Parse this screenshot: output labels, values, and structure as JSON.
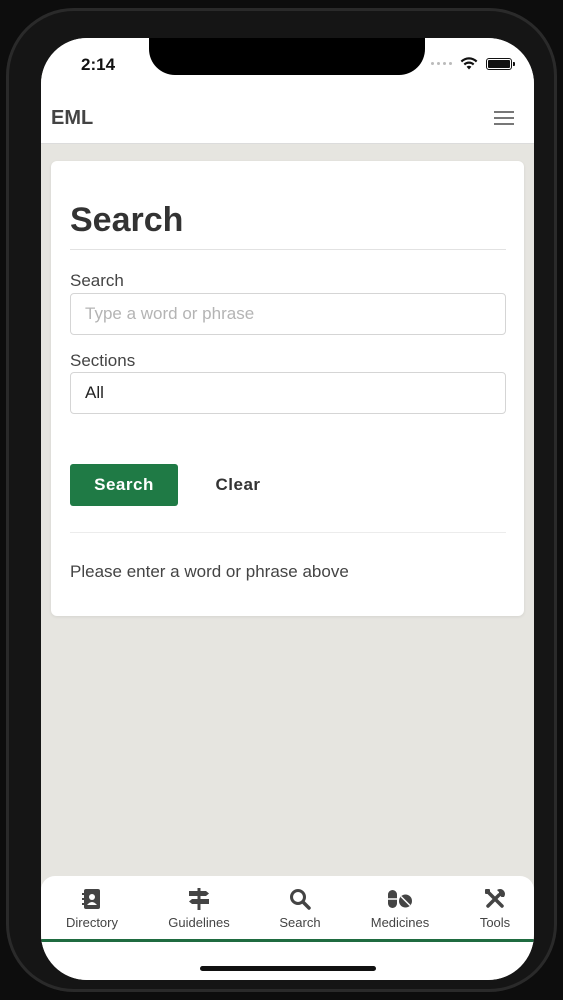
{
  "status_bar": {
    "time": "2:14",
    "icons": [
      "signal-dots-icon",
      "wifi-icon",
      "battery-icon"
    ]
  },
  "header": {
    "title": "EML",
    "menu_icon": "hamburger-menu-icon"
  },
  "search_card": {
    "title": "Search",
    "search_label": "Search",
    "search_value": "",
    "search_placeholder": "Type a word or phrase",
    "sections_label": "Sections",
    "sections_selected": "All",
    "search_button": "Search",
    "clear_button": "Clear",
    "result_message": "Please enter a word or phrase above"
  },
  "tab_bar": {
    "items": [
      {
        "label": "Directory",
        "icon": "address-book-icon"
      },
      {
        "label": "Guidelines",
        "icon": "signpost-icon"
      },
      {
        "label": "Search",
        "icon": "search-icon"
      },
      {
        "label": "Medicines",
        "icon": "pills-icon"
      },
      {
        "label": "Tools",
        "icon": "tools-icon"
      }
    ]
  },
  "colors": {
    "accent": "#1f7a45",
    "background": "#e6e5e0",
    "card": "#ffffff",
    "tab_indicator": "#1f6b40"
  }
}
